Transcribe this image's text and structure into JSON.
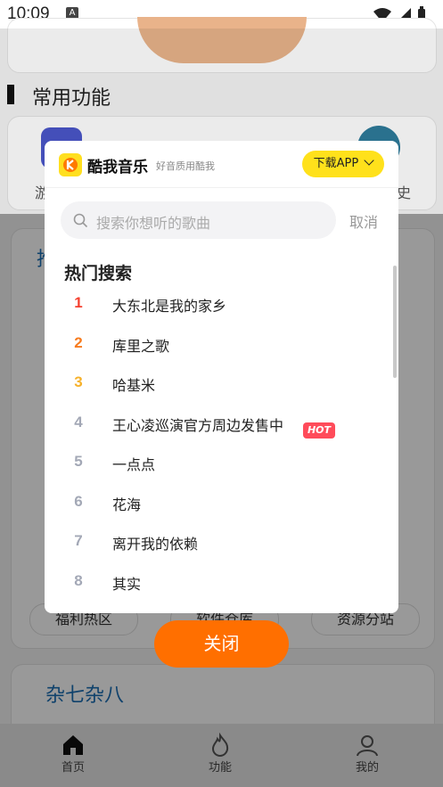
{
  "status_bar": {
    "time": "10:09",
    "notif_glyph": "A"
  },
  "background": {
    "section_title": "常用功能",
    "card_labels": [
      "游",
      "史",
      "推",
      "福利热区",
      "软件仓库",
      "资源分站",
      "杂七杂八"
    ],
    "nav": [
      {
        "label": "首页",
        "icon": "home-icon"
      },
      {
        "label": "功能",
        "icon": "flame-icon"
      },
      {
        "label": "我的",
        "icon": "user-icon"
      }
    ]
  },
  "modal": {
    "brand": "酷我音乐",
    "slogan": "好音质用酷我",
    "download_label": "下载APP",
    "search_placeholder": "搜索你想听的歌曲",
    "cancel_label": "取消",
    "hot_title": "热门搜索",
    "hot_badge": "HOT",
    "songs": [
      {
        "rank": "1",
        "title": "大东北是我的家乡",
        "color": "#f5402f"
      },
      {
        "rank": "2",
        "title": "库里之歌",
        "color": "#f77b1e"
      },
      {
        "rank": "3",
        "title": "哈基米",
        "color": "#f6b12a"
      },
      {
        "rank": "4",
        "title": "王心凌巡演官方周边发售中",
        "color": "#a3a8b6"
      },
      {
        "rank": "5",
        "title": "一点点",
        "color": "#a3a8b6"
      },
      {
        "rank": "6",
        "title": "花海",
        "color": "#a3a8b6"
      },
      {
        "rank": "7",
        "title": "离开我的依赖",
        "color": "#a3a8b6"
      },
      {
        "rank": "8",
        "title": "其实",
        "color": "#a3a8b6"
      }
    ]
  },
  "close_label": "关闭",
  "colors": {
    "accent": "#ff6f00",
    "brand_yellow": "#ffe11b"
  }
}
